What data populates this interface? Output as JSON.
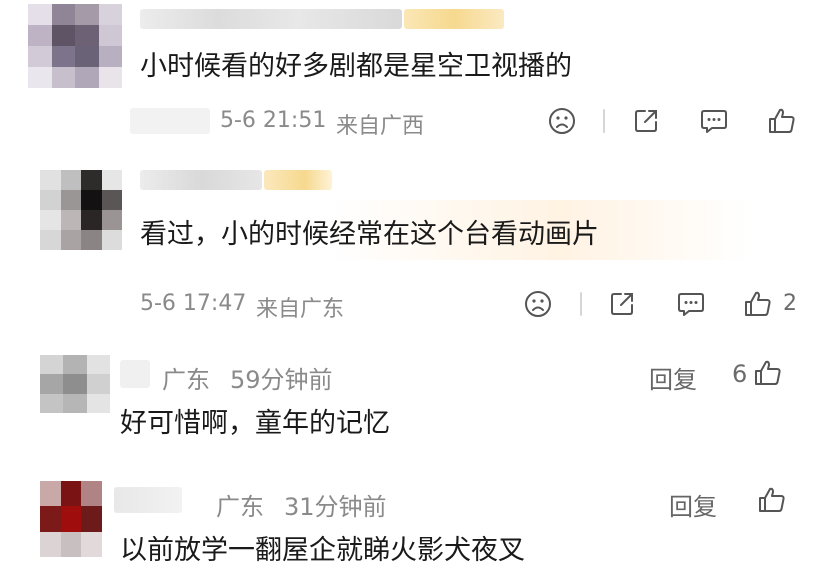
{
  "comments": [
    {
      "text": "小时候看的好多剧都是星空卫视播的",
      "time": "5-6 21:51",
      "location": "来自广西"
    },
    {
      "text": "看过，小的时候经常在这个台看动画片",
      "time": "5-6 17:47",
      "location": "来自广东",
      "like_count": "2"
    }
  ],
  "replies": [
    {
      "location": "广东",
      "time": "59分钟前",
      "reply_label": "回复",
      "like_count": "6",
      "text": "好可惜啊，童年的记忆"
    },
    {
      "location": "广东",
      "time": "31分钟前",
      "reply_label": "回复",
      "text": "以前放学一翻屋企就睇火影犬夜叉"
    }
  ],
  "icons": {
    "dislike": "frown-face-icon",
    "share": "share-icon",
    "comment": "comment-icon",
    "like": "thumbs-up-icon"
  },
  "colors": {
    "text": "#1a1a1a",
    "meta": "#8a8a8a",
    "icon": "#555555",
    "vip_badge": "#f6d98f"
  }
}
